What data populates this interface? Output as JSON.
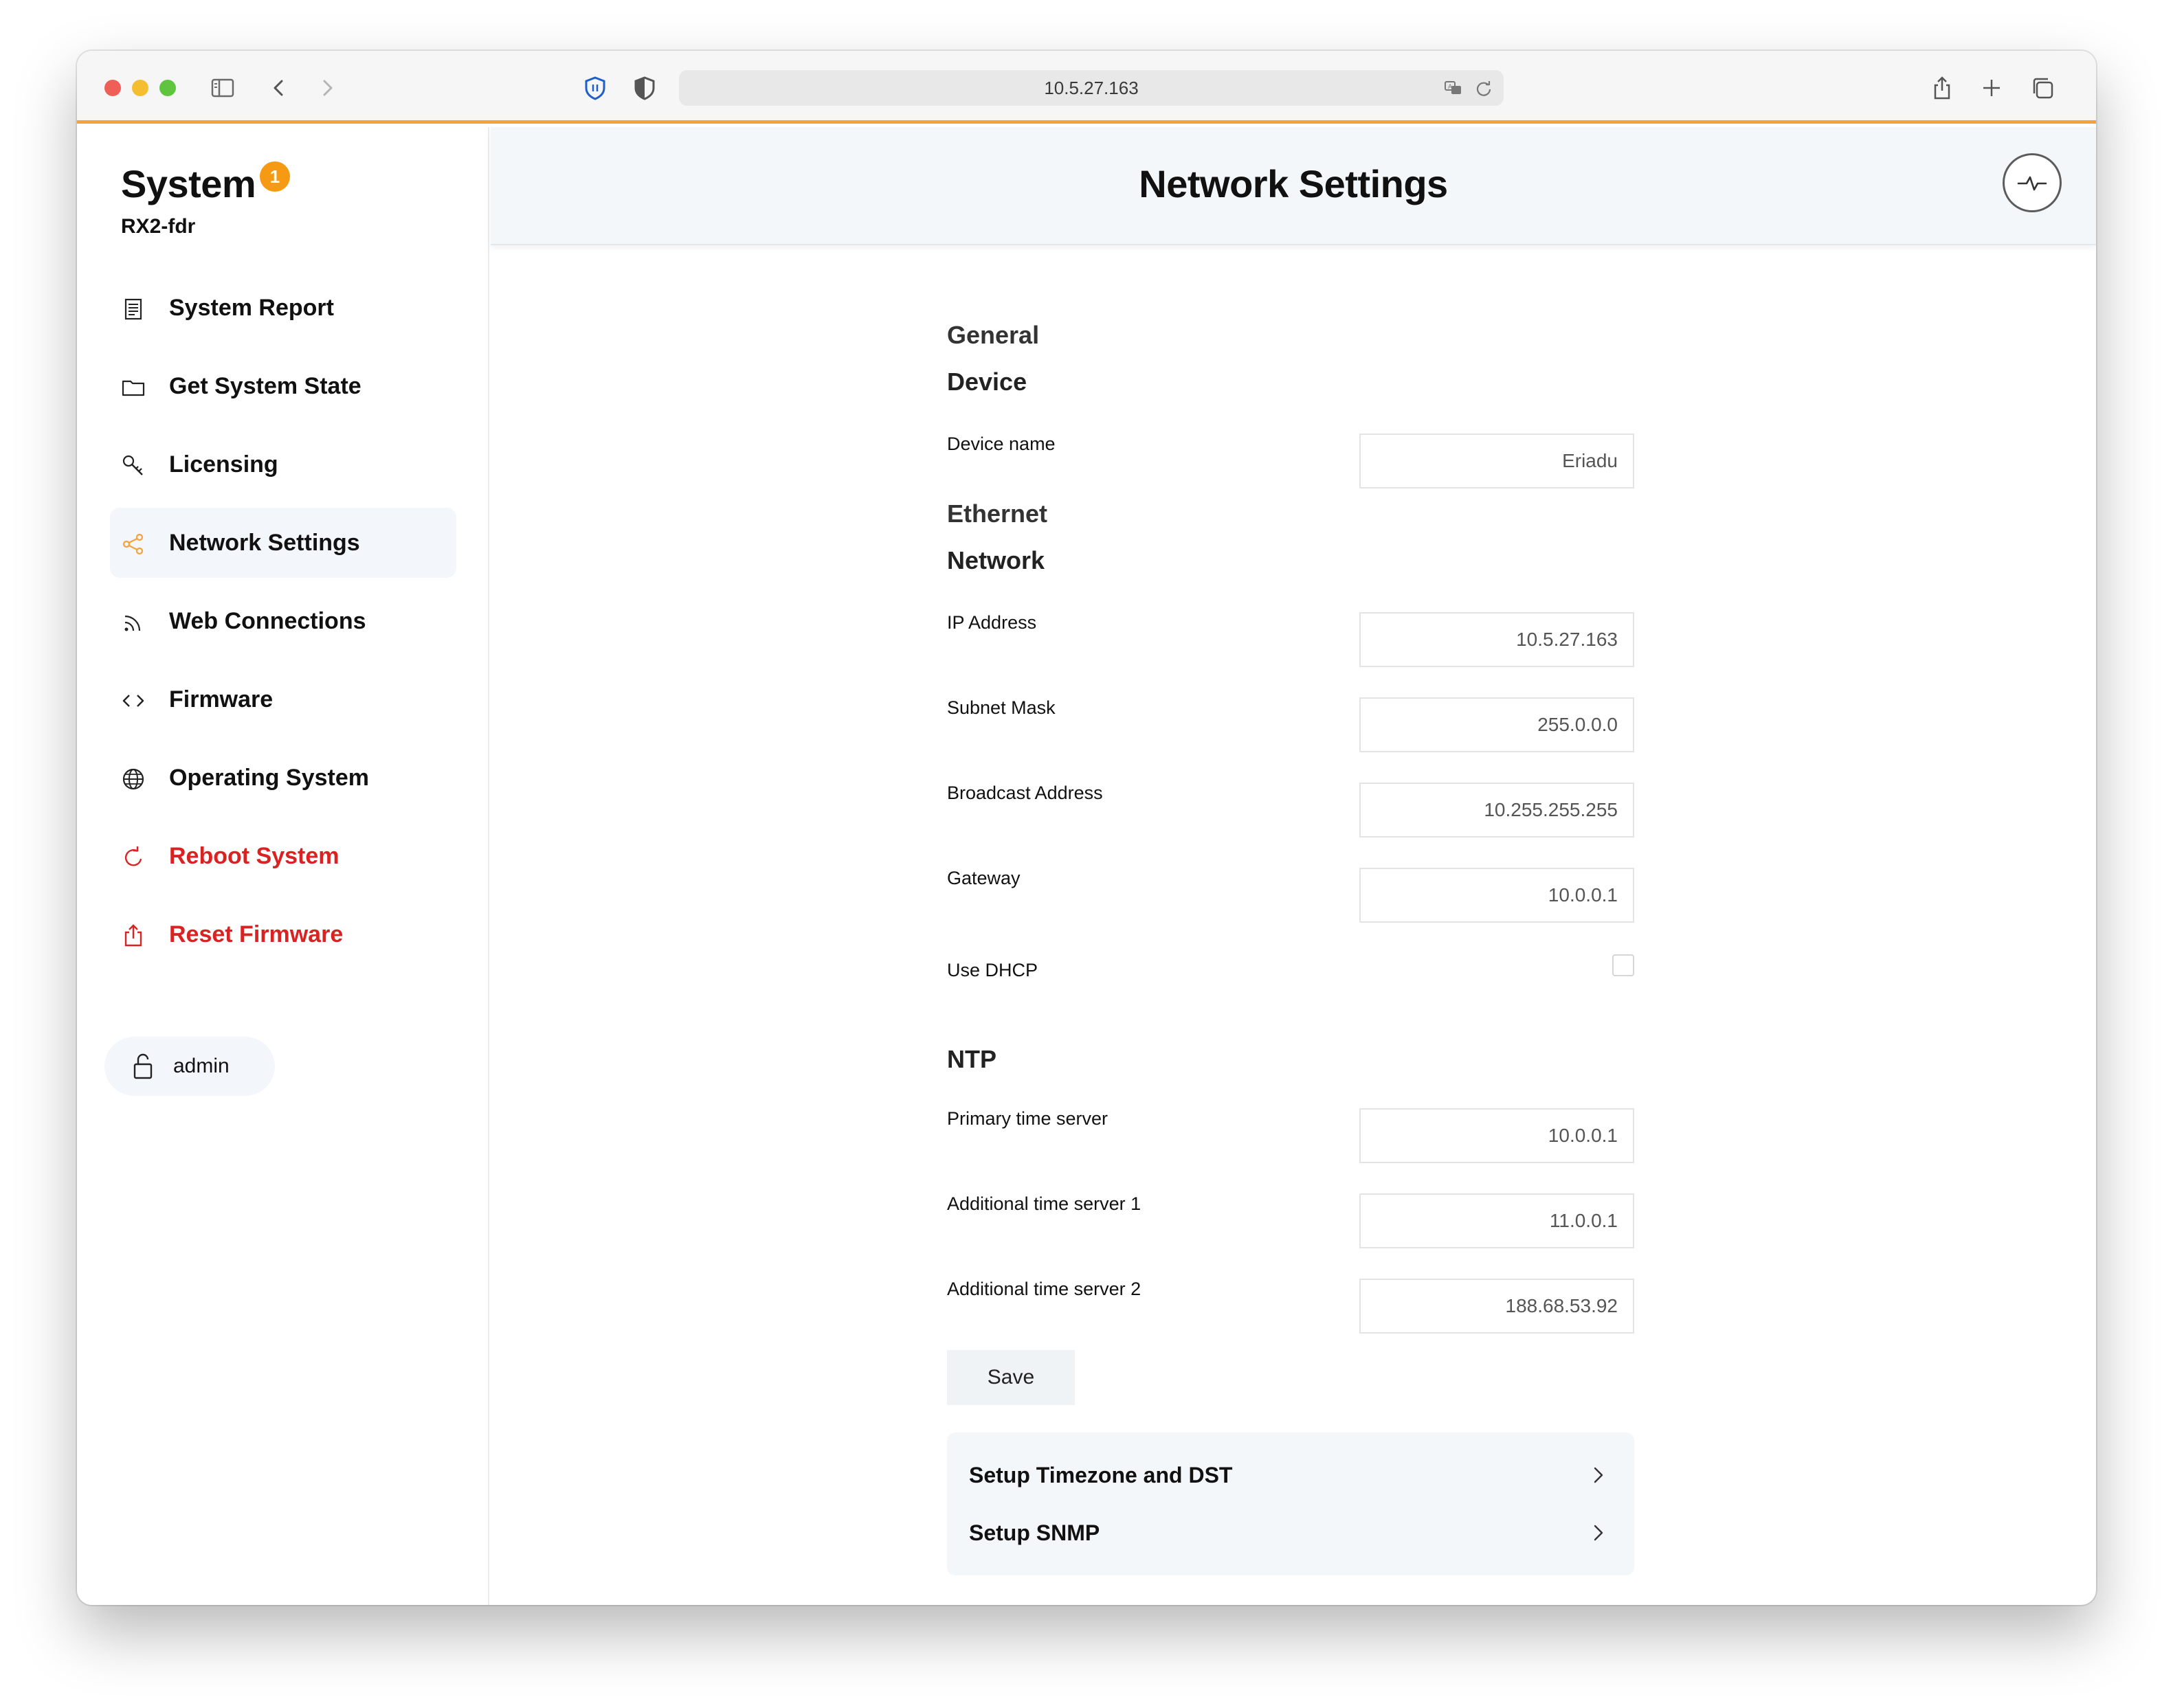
{
  "browser": {
    "url": "10.5.27.163"
  },
  "sidebar": {
    "title": "System",
    "badge": "1",
    "subtitle": "RX2-fdr",
    "items": [
      {
        "label": "System Report",
        "icon": "document-icon"
      },
      {
        "label": "Get System State",
        "icon": "folder-icon"
      },
      {
        "label": "Licensing",
        "icon": "key-icon"
      },
      {
        "label": "Network Settings",
        "icon": "share-network-icon",
        "active": true
      },
      {
        "label": "Web Connections",
        "icon": "rss-icon"
      },
      {
        "label": "Firmware",
        "icon": "code-icon"
      },
      {
        "label": "Operating System",
        "icon": "globe-icon"
      },
      {
        "label": "Reboot System",
        "icon": "reload-icon",
        "danger": true
      },
      {
        "label": "Reset Firmware",
        "icon": "upload-icon",
        "danger": true
      }
    ],
    "user": "admin"
  },
  "main": {
    "title": "Network Settings",
    "sections": {
      "general": "General",
      "device": "Device",
      "ethernet": "Ethernet",
      "network": "Network",
      "ntp": "NTP"
    },
    "fields": {
      "device_name": {
        "label": "Device name",
        "value": "Eriadu"
      },
      "ip_address": {
        "label": "IP Address",
        "value": "10.5.27.163"
      },
      "subnet_mask": {
        "label": "Subnet Mask",
        "value": "255.0.0.0"
      },
      "broadcast": {
        "label": "Broadcast Address",
        "value": "10.255.255.255"
      },
      "gateway": {
        "label": "Gateway",
        "value": "10.0.0.1"
      },
      "dhcp": {
        "label": "Use DHCP",
        "checked": false
      },
      "ntp_primary": {
        "label": "Primary time server",
        "value": "10.0.0.1"
      },
      "ntp_add1": {
        "label": "Additional time server 1",
        "value": "11.0.0.1"
      },
      "ntp_add2": {
        "label": "Additional time server 2",
        "value": "188.68.53.92"
      }
    },
    "save_label": "Save",
    "links": [
      {
        "label": "Setup Timezone and DST"
      },
      {
        "label": "Setup SNMP"
      }
    ]
  },
  "colors": {
    "accent": "#f5a23d",
    "badge": "#f59a12",
    "danger": "#d92323",
    "active_bg": "#f3f6fa"
  }
}
